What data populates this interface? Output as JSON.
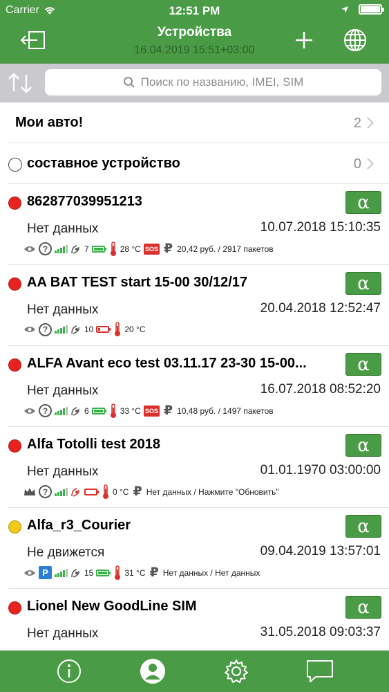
{
  "status_bar": {
    "carrier": "Carrier",
    "time": "12:51 PM"
  },
  "nav": {
    "title": "Устройства",
    "subtitle": "16.04.2019 15:51+03:00"
  },
  "search": {
    "placeholder": "Поиск по названию, IMEI, SIM"
  },
  "groups": [
    {
      "name": "Мои авто!",
      "count": "2"
    },
    {
      "name": "составное устройство",
      "count": "0"
    }
  ],
  "devices": [
    {
      "name": "862877039951213",
      "status": "Нет данных",
      "datetime": "10.07.2018 15:10:35",
      "dot_color": "#e8221f",
      "sats": "7",
      "temp": "28 °C",
      "balance": "20,42 руб. / 2917 пакетов",
      "alpha": "α"
    },
    {
      "name": "AA BAT TEST start 15-00 30/12/17",
      "status": "Нет данных",
      "datetime": "20.04.2018 12:52:47",
      "dot_color": "#e8221f",
      "sats": "10",
      "temp": "20 °C",
      "balance": "",
      "alpha": "α"
    },
    {
      "name": "ALFA Avant eco test 03.11.17 23-30 15-00...",
      "status": "Нет данных",
      "datetime": "16.07.2018 08:52:20",
      "dot_color": "#e8221f",
      "sats": "6",
      "temp": "33 °C",
      "balance": "10,48 руб. / 1497 пакетов",
      "alpha": "α"
    },
    {
      "name": "Alfa Totolli test 2018",
      "status": "Нет данных",
      "datetime": "01.01.1970 03:00:00",
      "dot_color": "#e8221f",
      "sats": "",
      "temp": "0 °C",
      "balance": "Нет данных / Нажмите \"Обновить\"",
      "alpha": "α"
    },
    {
      "name": "Alfa_r3_Courier",
      "status": "Не движется",
      "datetime": "09.04.2019 13:57:01",
      "dot_color": "#f2c81b",
      "sats": "15",
      "temp": "31 °C",
      "balance": "Нет данных / Нет данных",
      "alpha": "α"
    },
    {
      "name": "Lionel New GoodLine SIM",
      "status": "Нет данных",
      "datetime": "31.05.2018 09:03:37",
      "dot_color": "#e8221f",
      "sats": "",
      "temp": "",
      "balance": "",
      "alpha": "α"
    }
  ],
  "tabbar": [
    "info-icon",
    "profile-icon",
    "settings-icon",
    "chat-icon"
  ],
  "colors": {
    "brand_green": "#4a9b45",
    "search_bg": "#c9c9ce",
    "red_dot": "#e8221f",
    "yellow_dot": "#f2c81b"
  }
}
